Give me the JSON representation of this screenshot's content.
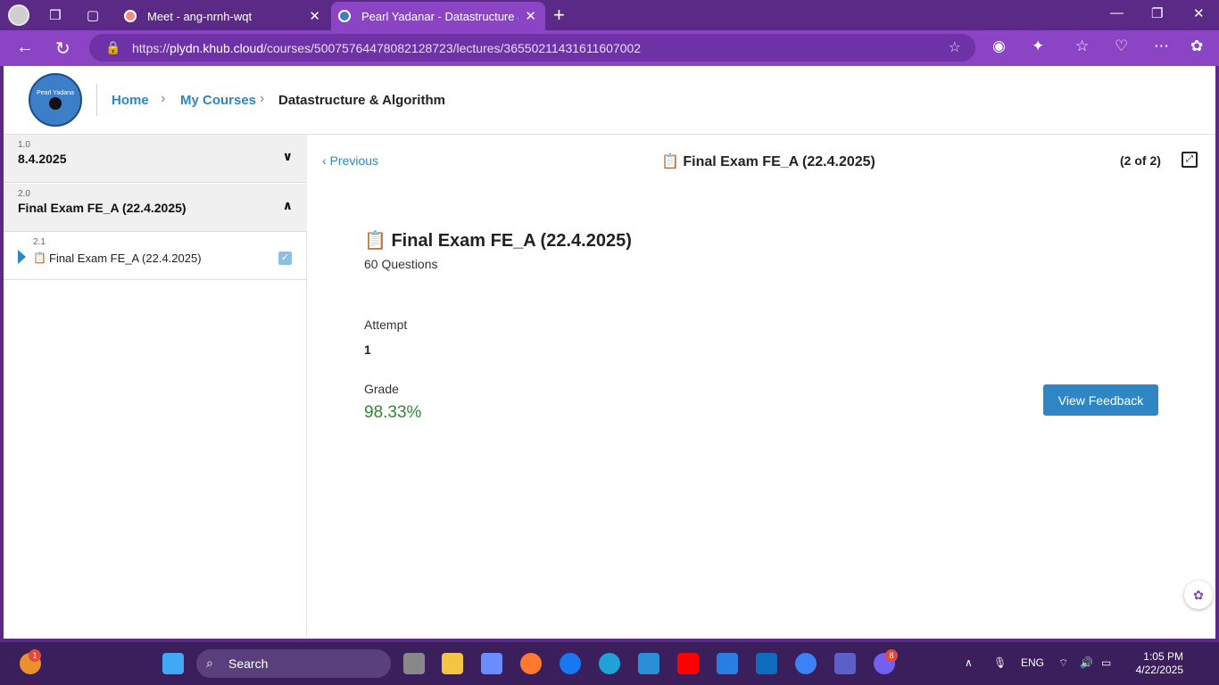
{
  "browser": {
    "tabs": [
      {
        "label": "Meet - ang-nrnh-wqt"
      },
      {
        "label": "Pearl Yadanar - Datastructure & A"
      }
    ],
    "url_prefix": "https://",
    "url_host": "plydn.khub.cloud",
    "url_path": "/courses/5007576447808212872​3/lectures/3655021143161160700​2"
  },
  "header": {
    "logo_text": "Pearl Yadana",
    "breadcrumb": {
      "home": "Home",
      "courses": "My Courses",
      "current": "Datastructure & Algorithm"
    }
  },
  "sidebar": {
    "sections": [
      {
        "num": "1.0",
        "title": "8.4.2025"
      },
      {
        "num": "2.0",
        "title": "Final Exam FE_A (22.4.2025)"
      }
    ],
    "lesson": {
      "num": "2.1",
      "title": "Final Exam FE_A (22.4.2025)"
    }
  },
  "main": {
    "prev_label": "Previous",
    "title": "Final Exam FE_A (22.4.2025)",
    "counter": "(2 of 2)",
    "exam_title": "Final Exam FE_A (22.4.2025)",
    "questions": "60 Questions",
    "attempt_label": "Attempt",
    "attempt_value": "1",
    "grade_label": "Grade",
    "grade_value": "98.33%",
    "feedback_button": "View Feedback"
  },
  "taskbar": {
    "search_label": "Search",
    "weather_badge": "1",
    "viber_badge": "8",
    "lang": "ENG",
    "time": "1:05 PM",
    "date": "4/22/2025"
  }
}
